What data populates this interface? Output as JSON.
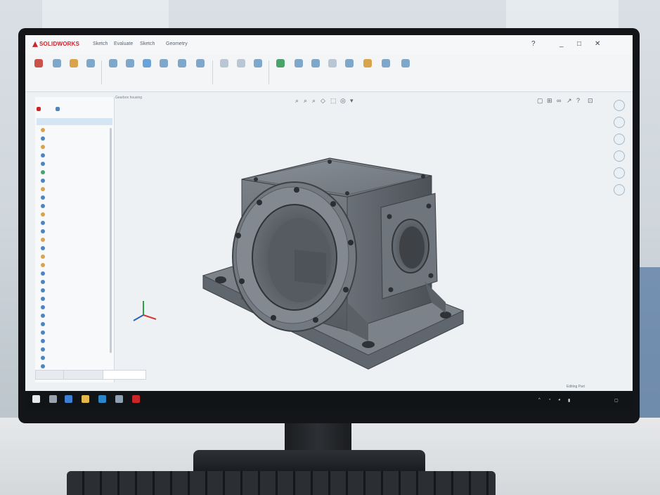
{
  "app": {
    "logo": "SOLIDWORKS",
    "menus": [
      "Sketch",
      "Evaluate",
      "Sketch",
      "Geometry"
    ],
    "window_controls": [
      "?",
      "_",
      "□",
      "✕"
    ]
  },
  "breadcrumb": "Gearbox housing",
  "status_text": "Editing Part",
  "icons": {
    "logo": "solidworks-logo-icon",
    "triad": "axis-triad-icon"
  },
  "colors": {
    "part": "#6d737a",
    "accent": "#c8262b",
    "tree_selected": "#d6e5f4"
  }
}
